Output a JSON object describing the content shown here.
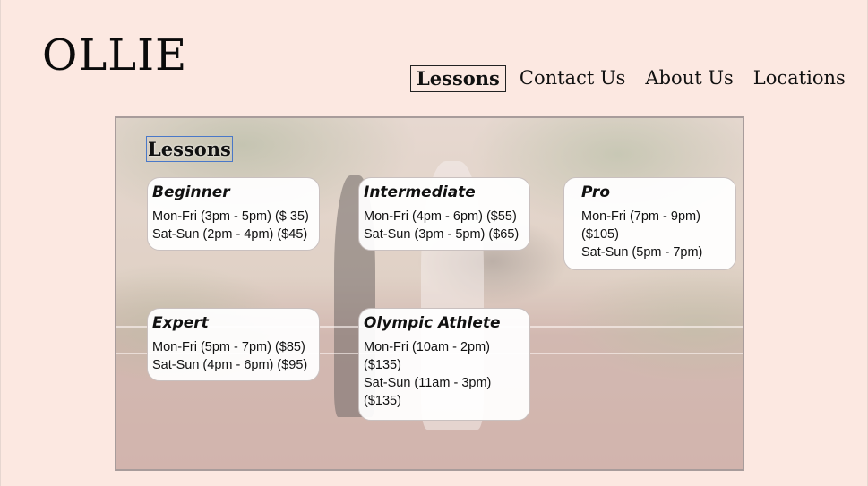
{
  "brand": {
    "logo_text": "OLLIE"
  },
  "nav": {
    "items": [
      {
        "label": "Lessons",
        "active": true
      },
      {
        "label": "Contact Us",
        "active": false
      },
      {
        "label": "About Us",
        "active": false
      },
      {
        "label": "Locations",
        "active": false
      }
    ]
  },
  "section": {
    "title": "Lessons"
  },
  "lessons": [
    {
      "name": "Beginner",
      "schedule": [
        "Mon-Fri (3pm - 5pm) ($ 35)",
        "Sat-Sun (2pm - 4pm) ($45)"
      ]
    },
    {
      "name": "Intermediate",
      "schedule": [
        "Mon-Fri (4pm - 6pm) ($55)",
        "Sat-Sun (3pm - 5pm) ($65)"
      ]
    },
    {
      "name": "Pro",
      "schedule": [
        "Mon-Fri (7pm - 9pm)",
        "($105)",
        "Sat-Sun (5pm - 7pm)"
      ]
    },
    {
      "name": "Expert",
      "schedule": [
        "Mon-Fri (5pm - 7pm) ($85)",
        "Sat-Sun (4pm - 6pm) ($95)"
      ]
    },
    {
      "name": "Olympic Athlete",
      "schedule": [
        "Mon-Fri (10am - 2pm)",
        "($135)",
        "Sat-Sun (11am - 3pm)",
        "($135)"
      ]
    }
  ],
  "colors": {
    "page_background": "#fce8e1",
    "text": "#111111",
    "card_background": "#ffffff",
    "selection_outline": "#4a78c8"
  }
}
